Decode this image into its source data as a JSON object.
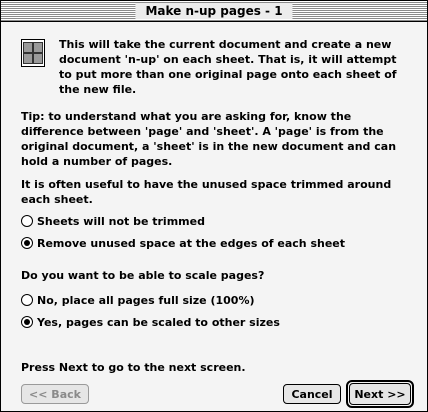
{
  "window": {
    "title": "Make n-up pages - 1"
  },
  "intro": {
    "icon": "multi-page-document-icon",
    "text": "This will take the current document and create a new document 'n-up' on each sheet. That is, it will attempt to put more than one original page onto each sheet of the new file."
  },
  "tip": "Tip: to understand what you are asking for, know the difference between 'page' and 'sheet'. A 'page' is from the original document, a 'sheet' is in the new document and can hold a number of pages.",
  "trim": {
    "question": "It is often useful to have the unused space trimmed around each sheet.",
    "options": [
      {
        "label": "Sheets will not be trimmed",
        "selected": false
      },
      {
        "label": "Remove unused space at the edges of each sheet",
        "selected": true
      }
    ]
  },
  "scale": {
    "question": "Do you want to be able to scale pages?",
    "options": [
      {
        "label": "No, place all pages full size (100%)",
        "selected": false
      },
      {
        "label": "Yes, pages can be scaled to other sizes",
        "selected": true
      }
    ]
  },
  "footer": {
    "instruction": "Press Next to go to the next screen.",
    "back_label": "<< Back",
    "cancel_label": "Cancel",
    "next_label": "Next >>"
  }
}
